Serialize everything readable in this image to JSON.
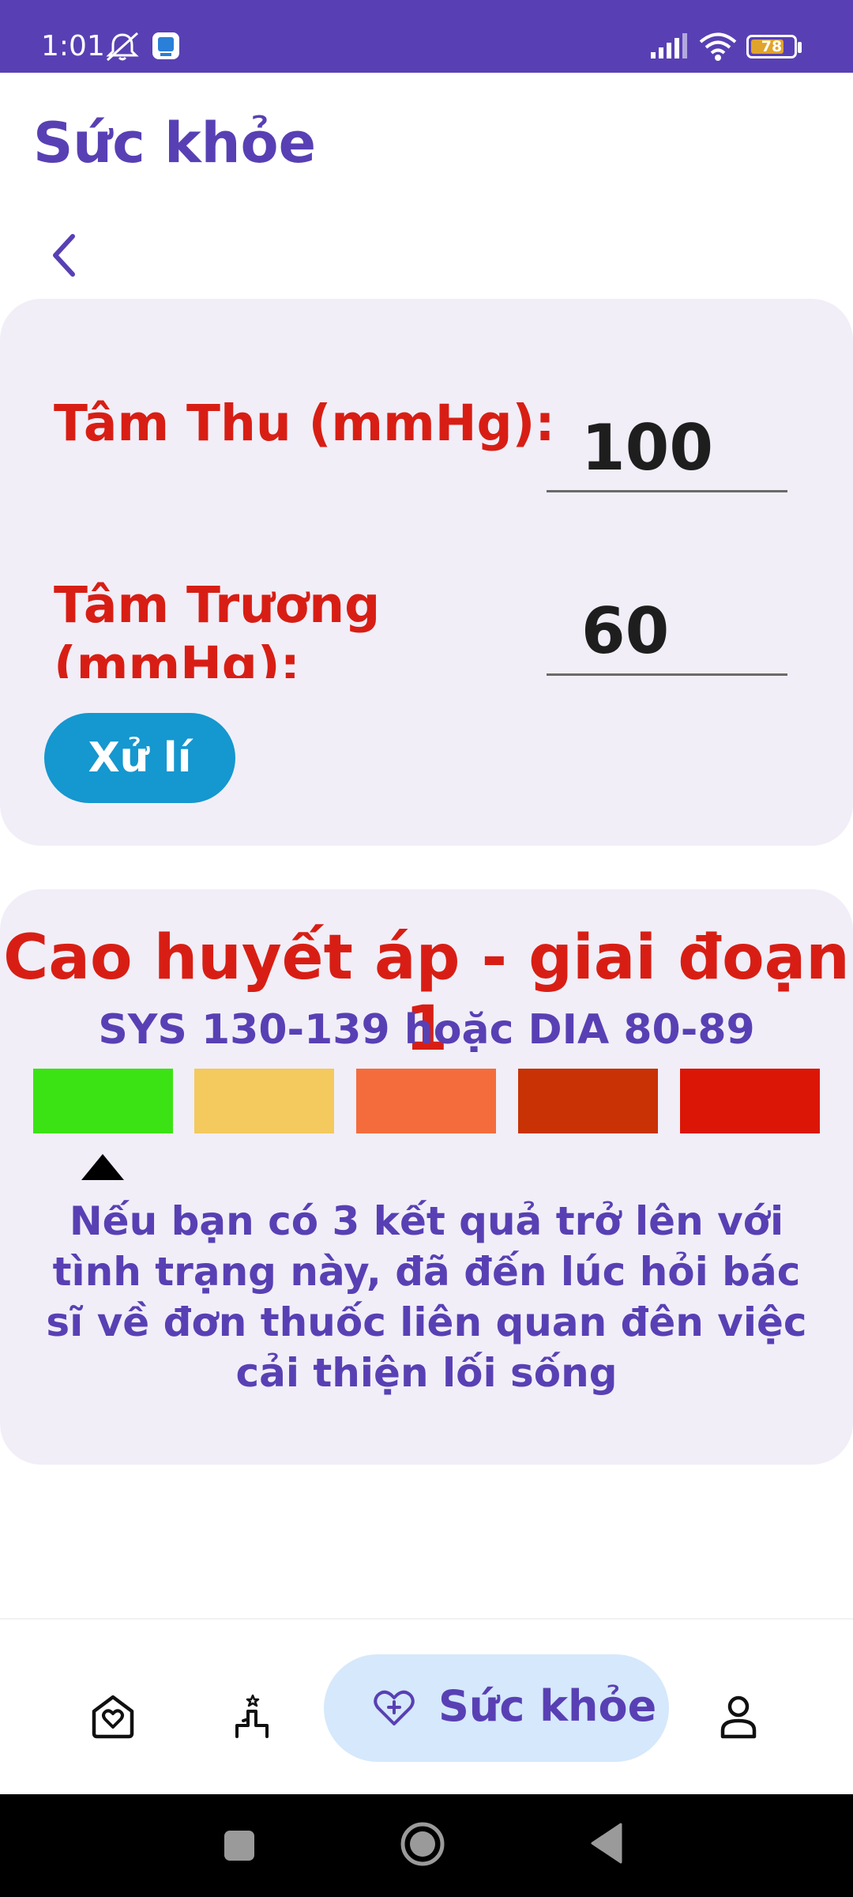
{
  "status_bar": {
    "time": "1:01",
    "battery": "78",
    "battery_level": 0.78
  },
  "header": {
    "title": "Sức khỏe"
  },
  "form": {
    "systolic_label": "Tâm Thu (mmHg):",
    "systolic_value": "100",
    "diastolic_label": "Tâm Trương (mmHg):",
    "diastolic_value": "60",
    "process_button": "Xử lí"
  },
  "result": {
    "title": "Cao huyết áp - giai đoạn 1",
    "range": "SYS 130-139 hoặc DIA 80-89",
    "scale_colors": [
      "#3ce314",
      "#f4c95d",
      "#f46c3c",
      "#c83204",
      "#dc1606"
    ],
    "marker_index": 0,
    "advice": "Nếu bạn có 3 kết quả trở lên với tình trạng này, đã đến lúc hỏi bác sĩ về đơn thuốc liên quan đên việc cải thiện lối sống"
  },
  "bottom_nav": {
    "items": [
      {
        "icon": "home-heart-icon"
      },
      {
        "icon": "exercise-icon"
      },
      {
        "icon": "heart-plus-icon",
        "label": "Sức khỏe",
        "active": true
      },
      {
        "icon": "profile-icon"
      }
    ]
  },
  "colors": {
    "primary": "#5840b4",
    "danger": "#d81e14",
    "button": "#1597cf",
    "card": "#f1eef8",
    "nav_active": "#d6e8fb"
  }
}
